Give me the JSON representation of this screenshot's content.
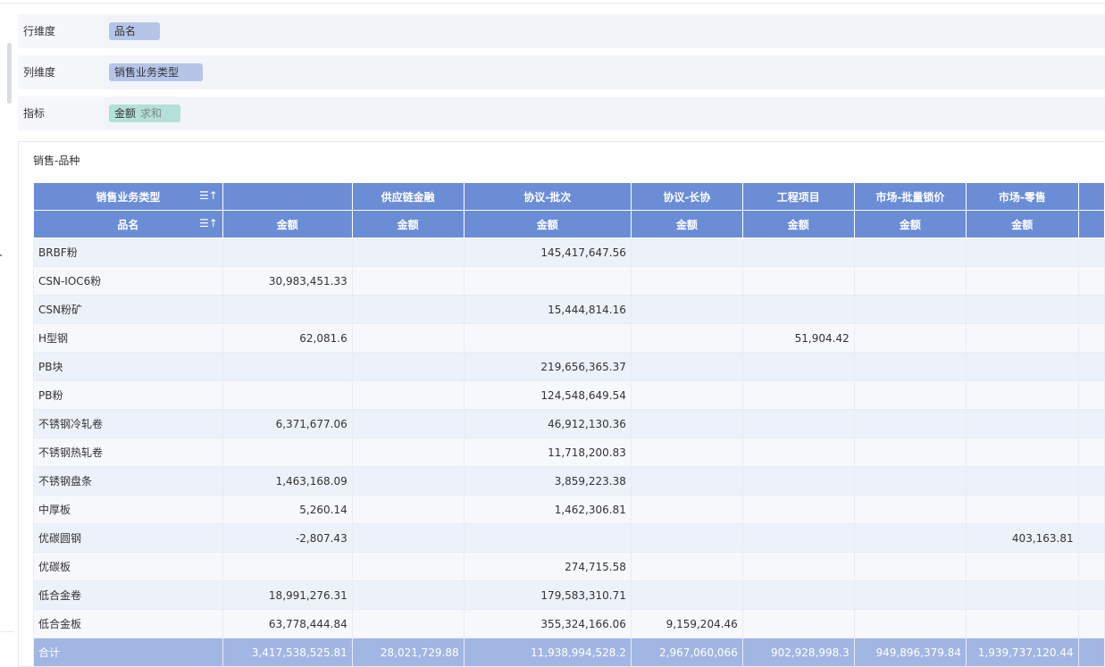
{
  "config": {
    "rows": {
      "label": "行维度",
      "chip": "品名"
    },
    "cols": {
      "label": "列维度",
      "chip": "销售业务类型"
    },
    "metric": {
      "label": "指标",
      "chip": "金额",
      "agg": "求和"
    }
  },
  "panel": {
    "title": "销售-品种",
    "header1_corner": "销售业务类型",
    "header2_corner": "品名",
    "col_groups": [
      "",
      "供应链金融",
      "协议-批次",
      "协议-长协",
      "工程项目",
      "市场-批量锁价",
      "市场-零售"
    ],
    "measure": "金额",
    "rows": [
      {
        "name": "BRBF粉",
        "values": [
          "",
          "",
          "145,417,647.56",
          "",
          "",
          "",
          ""
        ]
      },
      {
        "name": "CSN-IOC6粉",
        "values": [
          "30,983,451.33",
          "",
          "",
          "",
          "",
          "",
          ""
        ]
      },
      {
        "name": "CSN粉矿",
        "values": [
          "",
          "",
          "15,444,814.16",
          "",
          "",
          "",
          ""
        ]
      },
      {
        "name": "H型钢",
        "values": [
          "62,081.6",
          "",
          "",
          "",
          "51,904.42",
          "",
          ""
        ]
      },
      {
        "name": "PB块",
        "values": [
          "",
          "",
          "219,656,365.37",
          "",
          "",
          "",
          ""
        ]
      },
      {
        "name": "PB粉",
        "values": [
          "",
          "",
          "124,548,649.54",
          "",
          "",
          "",
          ""
        ]
      },
      {
        "name": "不锈钢冷轧卷",
        "values": [
          "6,371,677.06",
          "",
          "46,912,130.36",
          "",
          "",
          "",
          ""
        ]
      },
      {
        "name": "不锈钢热轧卷",
        "values": [
          "",
          "",
          "11,718,200.83",
          "",
          "",
          "",
          ""
        ]
      },
      {
        "name": "不锈钢盘条",
        "values": [
          "1,463,168.09",
          "",
          "3,859,223.38",
          "",
          "",
          "",
          ""
        ]
      },
      {
        "name": "中厚板",
        "values": [
          "5,260.14",
          "",
          "1,462,306.81",
          "",
          "",
          "",
          ""
        ]
      },
      {
        "name": "优碳圆钢",
        "values": [
          "-2,807.43",
          "",
          "",
          "",
          "",
          "",
          "403,163.81"
        ]
      },
      {
        "name": "优碳板",
        "values": [
          "",
          "",
          "274,715.58",
          "",
          "",
          "",
          ""
        ]
      },
      {
        "name": "低合金卷",
        "values": [
          "18,991,276.31",
          "",
          "179,583,310.71",
          "",
          "",
          "",
          ""
        ]
      },
      {
        "name": "低合金板",
        "values": [
          "63,778,444.84",
          "",
          "355,324,166.06",
          "9,159,204.46",
          "",
          "",
          ""
        ]
      }
    ],
    "total": {
      "name": "合计",
      "values": [
        "3,417,538,525.81",
        "28,021,729.88",
        "11,938,994,528.2",
        "2,967,060,066",
        "902,928,998.3",
        "949,896,379.84",
        "1,939,737,120.44"
      ]
    }
  },
  "icons": {
    "sort": "sort-ascending-icon"
  },
  "colors": {
    "header": "#6b8dd6",
    "total": "#a1b6e3",
    "row_odd": "#edf1f9",
    "row_even": "#f7f8fc",
    "chip_blue": "#b4c5e8",
    "chip_green": "#b4e0da"
  }
}
